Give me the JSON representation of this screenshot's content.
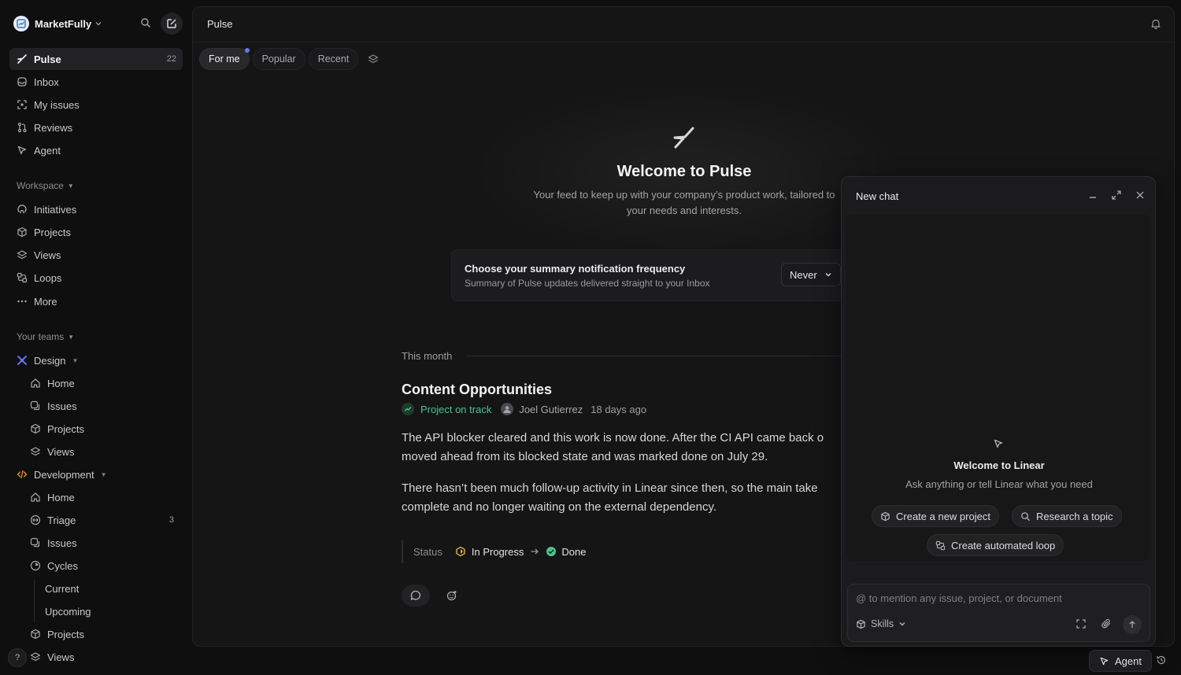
{
  "workspace": {
    "name": "MarketFully"
  },
  "nav": {
    "pulse": {
      "label": "Pulse",
      "count": "22"
    },
    "inbox": "Inbox",
    "my_issues": "My issues",
    "reviews": "Reviews",
    "agent": "Agent"
  },
  "workspace_section": {
    "header": "Workspace",
    "items": [
      "Initiatives",
      "Projects",
      "Views",
      "Loops",
      "More"
    ]
  },
  "teams_section": {
    "header": "Your teams",
    "design": {
      "name": "Design",
      "items": [
        "Home",
        "Issues",
        "Projects",
        "Views"
      ]
    },
    "development": {
      "name": "Development",
      "home": "Home",
      "triage": {
        "label": "Triage",
        "count": "3"
      },
      "issues": "Issues",
      "cycles": "Cycles",
      "current": "Current",
      "upcoming": "Upcoming",
      "projects": "Projects",
      "views": "Views"
    }
  },
  "help_label": "?",
  "main": {
    "title": "Pulse",
    "tabs": [
      "For me",
      "Popular",
      "Recent"
    ],
    "welcome_title": "Welcome to Pulse",
    "welcome_sub": "Your feed to keep up with your company’s product work, tailored to your needs and interests.",
    "notif": {
      "title": "Choose your summary notification frequency",
      "sub": "Summary of Pulse updates delivered straight to your Inbox",
      "value": "Never"
    },
    "month_label": "This month",
    "post": {
      "title": "Content Opportunities",
      "status": "Project on track",
      "author": "Joel Gutierrez",
      "time": "18 days ago",
      "body1_line1": "The API blocker cleared and this work is now done. After the CI API came back o",
      "body1_line2": "moved ahead from its blocked state and was marked done on July 29.",
      "body2_line1": "There hasn’t been much follow-up activity in Linear since then, so the main take",
      "body2_line2": "complete and no longer waiting on the external dependency.",
      "status_label": "Status",
      "status_from": "In Progress",
      "status_to": "Done"
    }
  },
  "chat": {
    "title": "New chat",
    "welcome": "Welcome to Linear",
    "sub": "Ask anything or tell Linear what you need",
    "chips": [
      "Create a new project",
      "Research a topic",
      "Create automated loop"
    ],
    "placeholder": "@ to mention any issue, project, or document",
    "skills_label": "Skills"
  },
  "bottom": {
    "agent_label": "Agent"
  },
  "colors": {
    "accent_dot": "#6b74f2",
    "on_track": "#4cc38a",
    "in_progress": "#e0b43a",
    "done": "#4cc38a"
  }
}
